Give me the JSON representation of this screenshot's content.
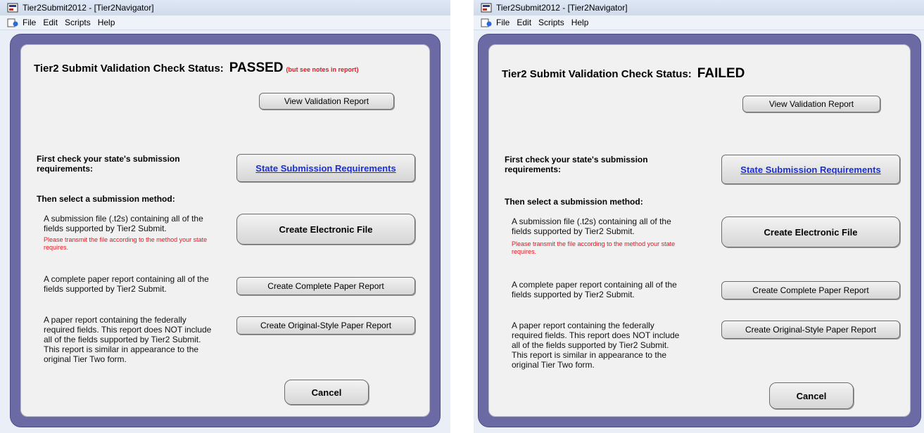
{
  "left": {
    "window_title": "Tier2Submit2012 - [Tier2Navigator]",
    "menu": [
      "File",
      "Edit",
      "Scripts",
      "Help"
    ],
    "status_label": "Tier2 Submit Validation Check Status:",
    "status_value": "PASSED",
    "status_note": "(but see notes in report)",
    "view_report_label": "View Validation Report",
    "first_check_text": "First check your state's submission requirements:",
    "state_requirements_label": "State Submission Requirements",
    "select_method_text": "Then select a submission method:",
    "electronic_desc": "A submission file (.t2s) containing all of the fields supported by Tier2 Submit.",
    "electronic_note": "Please transmit the file according to the method your state requires.",
    "electronic_button": "Create Electronic File",
    "complete_desc": "A complete paper report containing all of the  fields supported by Tier2 Submit.",
    "complete_button": "Create Complete Paper Report",
    "original_desc": "A paper report containing the federally required fields.  This report does NOT include all of the fields supported by Tier2 Submit.  This report is similar in appearance to the original Tier Two form.",
    "original_button": "Create Original-Style Paper Report",
    "cancel_label": "Cancel"
  },
  "right": {
    "window_title": "Tier2Submit2012 - [Tier2Navigator]",
    "menu": [
      "File",
      "Edit",
      "Scripts",
      "Help"
    ],
    "status_label": "Tier2 Submit Validation Check Status:",
    "status_value": "FAILED",
    "view_report_label": "View Validation Report",
    "first_check_text": "First check your state's submission requirements:",
    "state_requirements_label": "State Submission Requirements",
    "select_method_text": "Then select a submission method:",
    "electronic_desc": "A submission file (.t2s) containing all of the fields supported by Tier2 Submit.",
    "electronic_note": "Please transmit the file according to the method your state requires.",
    "electronic_button": "Create Electronic File",
    "complete_desc": "A complete paper report containing all of the  fields supported by Tier2 Submit.",
    "complete_button": "Create Complete Paper Report",
    "original_desc": "A paper report containing the federally required fields.  This report does NOT include all of the fields supported by Tier2 Submit.  This report is similar in appearance to the original Tier Two form.",
    "original_button": "Create Original-Style Paper Report",
    "cancel_label": "Cancel"
  },
  "colors": {
    "frame": "#6b6aa4",
    "panel": "#f1f1f1",
    "passed_note": "#e8141e",
    "link": "#1a2fd8"
  }
}
